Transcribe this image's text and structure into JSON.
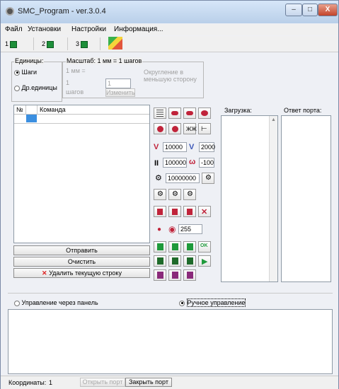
{
  "window": {
    "title": "SMC_Program - ver.3.0.4",
    "minimize": "–",
    "maximize": "□",
    "close": "X"
  },
  "menu": [
    "Файл",
    "Установки",
    "Настройки",
    "Информация..."
  ],
  "toolbar": {
    "axis1": "1",
    "axis2": "2",
    "axis3": "3"
  },
  "units": {
    "group_label": "Единицы:",
    "steps": "Шаги",
    "other_units": "Др.единицы",
    "scale_label": "Масштаб: 1 мм = 1 шагов",
    "mm_eq": "1 мм =",
    "value": "1",
    "steps_word": "шагов",
    "rounding": "Округление в меньшую сторону",
    "rounding_value": "1",
    "change_button": "Изменить"
  },
  "command_table": {
    "col_num": "№",
    "col_cmd": "Команда"
  },
  "buttons": {
    "send": "Отправить",
    "clear": "Очистить",
    "delete_row": "Удалить текущую строку"
  },
  "params": {
    "v1": "10000",
    "v2": "2000",
    "pause": "100000",
    "angle": "-100",
    "target": "10000000",
    "count": "255"
  },
  "lists": {
    "load": "Загрузка:",
    "port_reply": "Ответ порта:"
  },
  "modes": {
    "panel": "Управление через панель",
    "manual": "Ручное управление"
  },
  "status": {
    "coords": "Координаты:",
    "coords_value": "1",
    "open_port": "Открыть порт",
    "close_port": "Закрыть порт"
  },
  "colors": {
    "accent_red": "#c0233a",
    "accent_green": "#1e9a3b",
    "selection_blue": "#3b8fe0"
  }
}
